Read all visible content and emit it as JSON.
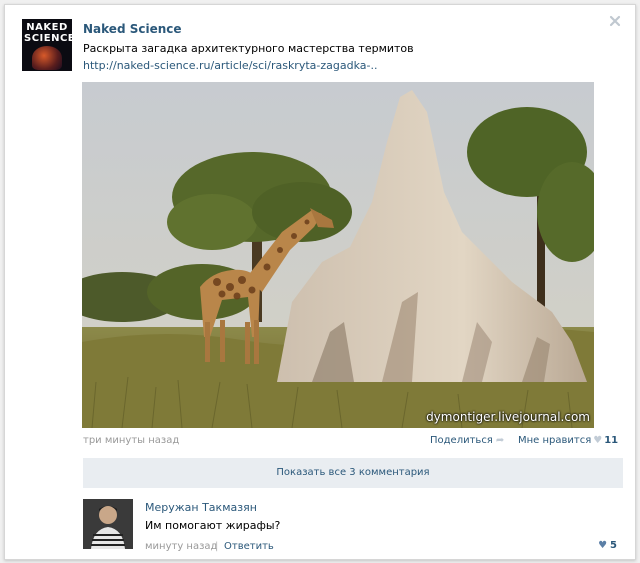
{
  "post": {
    "group_logo_line1": "NAKED",
    "group_logo_line2": "SCIENCE",
    "group_name": "Naked Science",
    "text": "Раскрыта загадка архитектурного мастерства термитов",
    "link": "http://naked-science.ru/article/sci/raskryta-zagadka-..",
    "photo_watermark": "dymontiger.livejournal.com",
    "time": "три минуты назад",
    "share_label": "Поделиться",
    "like_label": "Мне нравится",
    "like_count": "11",
    "show_comments_label": "Показать все 3 комментария"
  },
  "comment": {
    "author": "Меружан Такмазян",
    "text": "Им помогают жирафы?",
    "time": "минуту назад",
    "separator": "|",
    "reply_label": "Ответить",
    "like_count": "5"
  },
  "icons": {
    "close": "close-icon",
    "share": "share-arrow-icon",
    "like": "heart-icon"
  },
  "colors": {
    "link": "#2b587a",
    "muted": "#999999",
    "comments_bar": "#e9edf1"
  }
}
